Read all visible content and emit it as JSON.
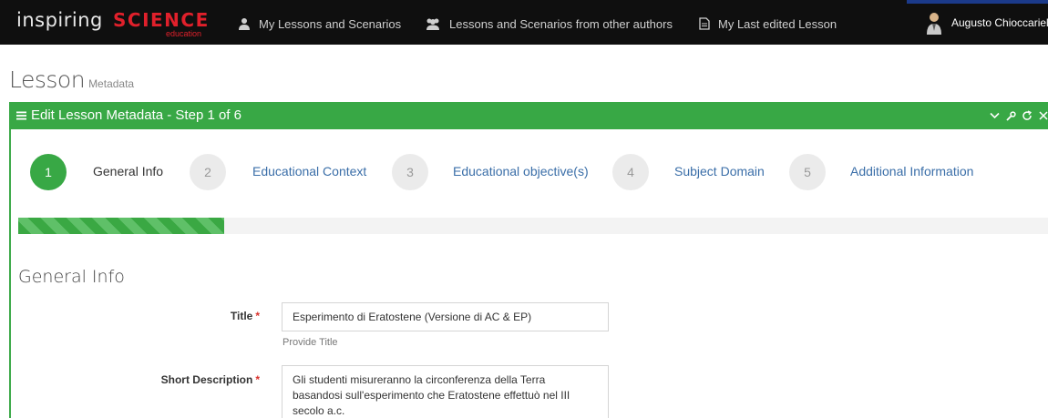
{
  "navbar": {
    "brand_main": "inspiring",
    "brand_accent": "SCIENCE",
    "brand_sub": "education",
    "items": [
      {
        "label": "My Lessons and Scenarios",
        "icon": "user-icon"
      },
      {
        "label": "Lessons and Scenarios from other authors",
        "icon": "users-icon"
      },
      {
        "label": "My Last edited Lesson",
        "icon": "document-icon"
      }
    ],
    "user_name": "Augusto Chioccariello"
  },
  "page": {
    "title": "Lesson",
    "subtitle": "Metadata"
  },
  "widget": {
    "title": "Edit Lesson Metadata - Step 1 of 6",
    "tools": [
      "chevron-down-icon",
      "wrench-icon",
      "refresh-icon",
      "close-icon"
    ]
  },
  "steps": [
    {
      "number": "1",
      "label": "General Info",
      "active": true
    },
    {
      "number": "2",
      "label": "Educational Context",
      "active": false
    },
    {
      "number": "3",
      "label": "Educational objective(s)",
      "active": false
    },
    {
      "number": "4",
      "label": "Subject Domain",
      "active": false
    },
    {
      "number": "5",
      "label": "Additional Information",
      "active": false
    }
  ],
  "progress": {
    "fraction": 0.2
  },
  "section": {
    "title": "General Info"
  },
  "form": {
    "title": {
      "label": "Title",
      "required_mark": "*",
      "value": "Esperimento di Eratostene (Versione di AC & EP)",
      "help": "Provide Title"
    },
    "short_description": {
      "label": "Short Description",
      "required_mark": "*",
      "value": "Gli studenti misureranno la circonferenza della Terra basandosi sull'esperimento che  Eratostene effettuò nel III secolo a.c."
    }
  },
  "colors": {
    "accent_green": "#38a845",
    "navbar_bg": "#0f0f0f",
    "brand_red": "#e0202b",
    "link_blue": "#3a6ea8"
  }
}
